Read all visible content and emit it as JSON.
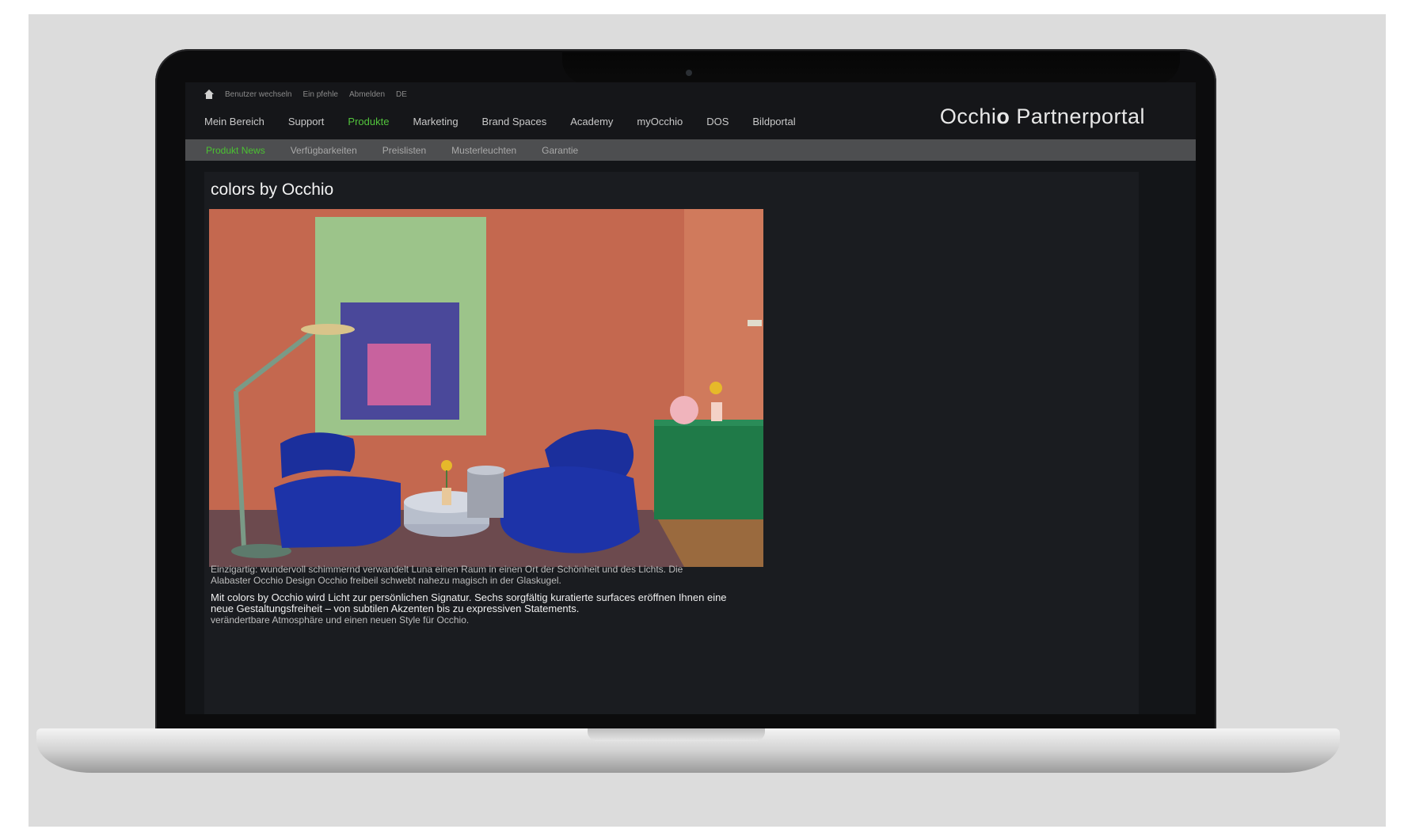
{
  "utility_bar": {
    "items": [
      "Benutzer wechseln",
      "Ein pfehle",
      "Abmelden",
      "DE"
    ]
  },
  "main_nav": {
    "items": [
      {
        "label": "Mein Bereich",
        "active": false
      },
      {
        "label": "Support",
        "active": false
      },
      {
        "label": "Produkte",
        "active": true
      },
      {
        "label": "Marketing",
        "active": false
      },
      {
        "label": "Brand Spaces",
        "active": false
      },
      {
        "label": "Academy",
        "active": false
      },
      {
        "label": "myOcchio",
        "active": false
      },
      {
        "label": "DOS",
        "active": false
      },
      {
        "label": "Bildportal",
        "active": false
      }
    ]
  },
  "brand": {
    "name_a": "Occhi",
    "name_b": "o",
    "name_c": " Partnerportal"
  },
  "sub_nav": {
    "items": [
      {
        "label": "Produkt News",
        "active": true
      },
      {
        "label": "Verfügbarkeiten",
        "active": false
      },
      {
        "label": "Preislisten",
        "active": false
      },
      {
        "label": "Musterleuchten",
        "active": false
      },
      {
        "label": "Garantie",
        "active": false
      }
    ]
  },
  "article": {
    "title": "colors by Occhio",
    "para1_line1": "Einzigartig: wundervoll schimmernd verwandelt Luna einen Raum in einen Ort der Schönheit und des Lichts. Die",
    "para1_line2": "Alabaster Occhio Design Occhio freibeil schwebt nahezu magisch in der Glaskugel.",
    "para2_line1": "Mit colors by Occhio wird Licht zur persönlichen Signatur. Sechs sorgfältig kuratierte surfaces eröffnen Ihnen eine",
    "para2_line2": "neue Gestaltungsfreiheit – von subtilen Akzenten bis zu expressiven Statements.",
    "para2_line3": "verändertbare Atmosphäre und einen neuen Style für Occhio."
  },
  "colors": {
    "accent": "#52c43c",
    "wall": "#c06650",
    "canvas_green": "#9cc48a",
    "canvas_purple": "#4a489a",
    "canvas_pink": "#c8629e",
    "chair_blue": "#1b2f9c",
    "cabinet_green": "#1f7a48"
  }
}
